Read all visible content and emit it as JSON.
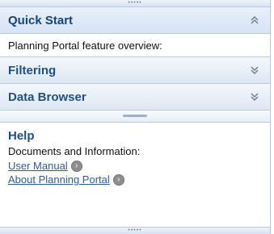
{
  "sections": [
    {
      "title": "Quick Start",
      "expanded": true,
      "icon": "double-chevron-up-icon"
    },
    {
      "title": "Filtering",
      "expanded": false,
      "icon": "double-chevron-down-icon"
    },
    {
      "title": "Data Browser",
      "expanded": false,
      "icon": "double-chevron-down-icon"
    }
  ],
  "quick_start": {
    "text": "Planning Portal feature overview:"
  },
  "help": {
    "title": "Help",
    "description": "Documents and Information:",
    "links": [
      {
        "label": "User Manual",
        "icon": "arrow-right-circle-icon"
      },
      {
        "label": "About Planning Portal",
        "icon": "arrow-right-circle-icon"
      }
    ]
  },
  "colors": {
    "accent": "#1f4f86",
    "border": "#b8cbe3",
    "link": "#2e5d98",
    "icon_gray": "#8f8f8f"
  }
}
